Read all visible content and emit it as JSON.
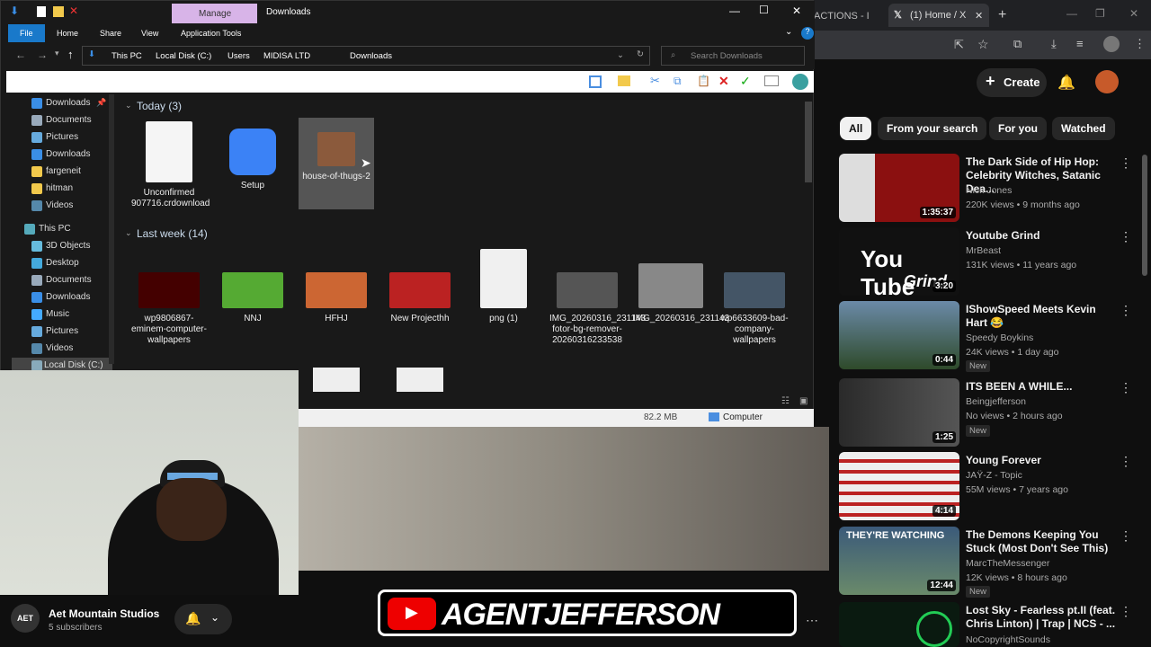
{
  "explorer": {
    "title": "Downloads",
    "manage_tab": "Manage",
    "ribbon": [
      "File",
      "Home",
      "Share",
      "View",
      "Application Tools"
    ],
    "breadcrumb": [
      "This PC",
      "Local Disk (C:)",
      "Users",
      "MIDISA LTD",
      "Downloads"
    ],
    "search_placeholder": "Search Downloads",
    "sidebar": [
      {
        "label": "Downloads",
        "icon": "download-arrow-icon",
        "color": "#3a8ee6"
      },
      {
        "label": "Documents",
        "icon": "documents-icon",
        "color": "#9ab"
      },
      {
        "label": "Pictures",
        "icon": "pictures-icon",
        "color": "#6ad"
      },
      {
        "label": "Downloads",
        "icon": "download-arrow-icon",
        "color": "#3a8ee6"
      },
      {
        "label": "fargeneit",
        "icon": "folder-icon",
        "color": "#f2c94c"
      },
      {
        "label": "hitman",
        "icon": "folder-icon",
        "color": "#f2c94c"
      },
      {
        "label": "Videos",
        "icon": "videos-icon",
        "color": "#58a"
      },
      {
        "label": "This PC",
        "icon": "computer-icon",
        "color": "#5ab"
      },
      {
        "label": "3D Objects",
        "icon": "3d-objects-icon",
        "color": "#6bd"
      },
      {
        "label": "Desktop",
        "icon": "desktop-icon",
        "color": "#4ad"
      },
      {
        "label": "Documents",
        "icon": "documents-icon",
        "color": "#9ab"
      },
      {
        "label": "Downloads",
        "icon": "download-arrow-icon",
        "color": "#3a8ee6"
      },
      {
        "label": "Music",
        "icon": "music-icon",
        "color": "#4af"
      },
      {
        "label": "Pictures",
        "icon": "pictures-icon",
        "color": "#6ad"
      },
      {
        "label": "Videos",
        "icon": "videos-icon",
        "color": "#58a"
      },
      {
        "label": "Local Disk (C:)",
        "icon": "drive-icon",
        "color": "#8ab"
      }
    ],
    "groups": {
      "today": "Today (3)",
      "last_week": "Last week (14)"
    },
    "today_files": [
      {
        "name": "Unconfirmed 907716.crdownload",
        "color": "#f5f5f5"
      },
      {
        "name": "Setup",
        "color": "#3b82f6"
      },
      {
        "name": "house-of-thugs-2",
        "color": "#8b5a3c"
      }
    ],
    "week_files": [
      {
        "name": "wp9806867-eminem-computer-wallpapers",
        "color": "#400"
      },
      {
        "name": "NNJ",
        "color": "#5a3"
      },
      {
        "name": "HFHJ",
        "color": "#c63"
      },
      {
        "name": "New Projecthh",
        "color": "#b22"
      },
      {
        "name": "png (1)",
        "color": "#f0f0f0"
      },
      {
        "name": "IMG_20260316_231143-fotor-bg-remover-20260316233538",
        "color": "#555"
      },
      {
        "name": "IMG_20260316_231143",
        "color": "#888"
      },
      {
        "name": "wp6633609-bad-company-wallpapers",
        "color": "#456"
      }
    ],
    "status_size": "82.2 MB",
    "status_location": "Computer"
  },
  "chrome": {
    "tab1": "ACTIONS - I",
    "tab2": "(1) Home / X"
  },
  "youtube": {
    "create": "Create",
    "chips": [
      "All",
      "From your search",
      "For you",
      "Watched"
    ],
    "videos": [
      {
        "title": "The Dark Side of Hip Hop: Celebrity Witches, Satanic Dea...",
        "channel": "Nick Jones",
        "meta": "220K views • 9 months ago",
        "duration": "1:35:37",
        "new": "",
        "thumb": "#7a1a1a"
      },
      {
        "title": "Youtube Grind",
        "channel": "MrBeast",
        "meta": "131K views • 11 years ago",
        "duration": "3:20",
        "new": "",
        "thumb": "#111"
      },
      {
        "title": "IShowSpeed Meets Kevin Hart 😂",
        "channel": "Speedy Boykins",
        "meta": "24K views • 1 day ago",
        "duration": "0:44",
        "new": "New",
        "thumb": "#2e4a2a"
      },
      {
        "title": "ITS BEEN A WHILE...",
        "channel": "Beingjefferson",
        "meta": "No views • 2 hours ago",
        "duration": "1:25",
        "new": "New",
        "thumb": "#3a3a3a"
      },
      {
        "title": "Young Forever",
        "channel": "JAŸ-Z - Topic",
        "meta": "55M views • 7 years ago",
        "duration": "4:14",
        "new": "",
        "thumb": "#ddd"
      },
      {
        "title": "The Demons Keeping You Stuck (Most Don't See This)",
        "channel": "MarcTheMessenger",
        "meta": "12K views • 8 hours ago",
        "duration": "12:44",
        "new": "New",
        "thumb": "#3b5a7a"
      },
      {
        "title": "Lost Sky - Fearless pt.II (feat. Chris Linton) | Trap | NCS - ...",
        "channel": "NoCopyrightSounds",
        "meta": "",
        "duration": "",
        "new": "",
        "thumb": "#0a2a1a"
      }
    ],
    "thumb2_text": "You Tube",
    "thumb2_sub": "Grind",
    "thumb5_text": "",
    "thumb6_text": "THEY'RE WATCHING"
  },
  "channel": {
    "name": "Aet Mountain Studios",
    "subs": "5 subscribers",
    "avatar": "AET"
  },
  "banner": {
    "text": "AGENTJEFFERSON"
  }
}
